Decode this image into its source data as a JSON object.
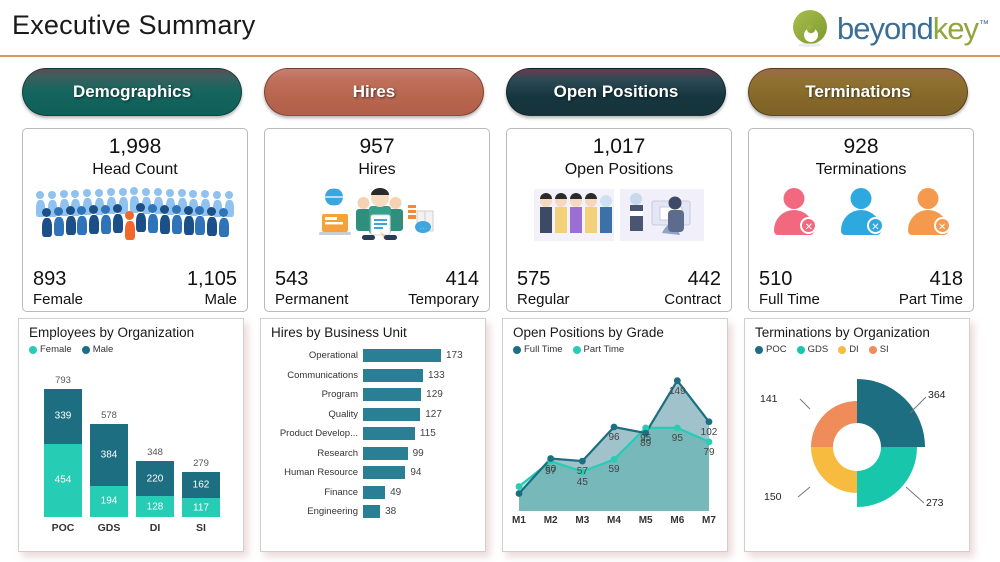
{
  "header": {
    "title": "Executive Summary",
    "logo": {
      "text_primary": "beyond",
      "text_secondary": "key",
      "trademark": "™"
    },
    "rule_color": "#d79a58"
  },
  "tabs": [
    {
      "label": "Demographics",
      "color": "#16655f",
      "name": "tab-demographics"
    },
    {
      "label": "Hires",
      "color": "#b9664f",
      "name": "tab-hires"
    },
    {
      "label": "Open Positions",
      "color": "#16363f",
      "name": "tab-open-positions"
    },
    {
      "label": "Terminations",
      "color": "#86682a",
      "name": "tab-terminations"
    }
  ],
  "kpi_cards": [
    {
      "total": "1,998",
      "label": "Head Count",
      "left_value": "893",
      "left_label": "Female",
      "right_value": "1,105",
      "right_label": "Male",
      "art": "crowd-people-icon"
    },
    {
      "total": "957",
      "label": "Hires",
      "left_value": "543",
      "left_label": "Permanent",
      "right_value": "414",
      "right_label": "Temporary",
      "art": "hiring-illustration-icon"
    },
    {
      "total": "1,017",
      "label": "Open Positions",
      "left_value": "575",
      "left_label": "Regular",
      "right_value": "442",
      "right_label": "Contract",
      "art": "candidates-interview-illustration-icon"
    },
    {
      "total": "928",
      "label": "Terminations",
      "left_value": "510",
      "left_label": "Full Time",
      "right_value": "418",
      "right_label": "Part Time",
      "art": "user-remove-icons"
    }
  ],
  "chart_data": [
    {
      "type": "bar",
      "title": "Employees by Organization",
      "orientation": "vertical-stacked",
      "categories": [
        "POC",
        "GDS",
        "DI",
        "SI"
      ],
      "totals": [
        793,
        578,
        348,
        279
      ],
      "series": [
        {
          "name": "Female",
          "color": "#26ccb4",
          "values": [
            454,
            194,
            128,
            117
          ]
        },
        {
          "name": "Male",
          "color": "#1d6e81",
          "values": [
            339,
            384,
            220,
            162
          ]
        }
      ],
      "ylim": [
        0,
        793
      ],
      "grid": false,
      "legend_position": "top-left"
    },
    {
      "type": "bar",
      "title": "Hires by Business Unit",
      "orientation": "horizontal",
      "categories": [
        "Operational",
        "Communications",
        "Program",
        "Quality",
        "Product Develop...",
        "Research",
        "Human Resource",
        "Finance",
        "Engineering"
      ],
      "values": [
        173,
        133,
        129,
        127,
        115,
        99,
        94,
        49,
        38
      ],
      "bar_color": "#2b7f95",
      "xlim": [
        0,
        173
      ],
      "grid": false
    },
    {
      "type": "area",
      "title": "Open Positions by Grade",
      "x": [
        "M1",
        "M2",
        "M3",
        "M4",
        "M5",
        "M6",
        "M7"
      ],
      "series": [
        {
          "name": "Full Time",
          "color": "#1d6e81",
          "values": [
            20,
            60,
            57,
            96,
            89,
            149,
            102
          ],
          "labels": [
            "",
            "60",
            "57",
            "96",
            "89",
            "149",
            "102"
          ]
        },
        {
          "name": "Part Time",
          "color": "#26ccb4",
          "values": [
            28,
            57,
            45,
            59,
            95,
            95,
            79
          ],
          "labels": [
            "",
            "57",
            "45",
            "59",
            "95",
            "95",
            "79"
          ]
        }
      ],
      "ylim": [
        0,
        160
      ],
      "grid": false,
      "legend_position": "top-left"
    },
    {
      "type": "pie",
      "title": "Terminations by Organization",
      "variant": "donut-rose",
      "labels": [
        "POC",
        "GDS",
        "DI",
        "SI"
      ],
      "values": [
        364,
        273,
        150,
        141
      ],
      "colors": [
        "#1d6e81",
        "#18c7ab",
        "#f7bb3f",
        "#f08b5a"
      ],
      "legend_position": "top-left"
    }
  ]
}
